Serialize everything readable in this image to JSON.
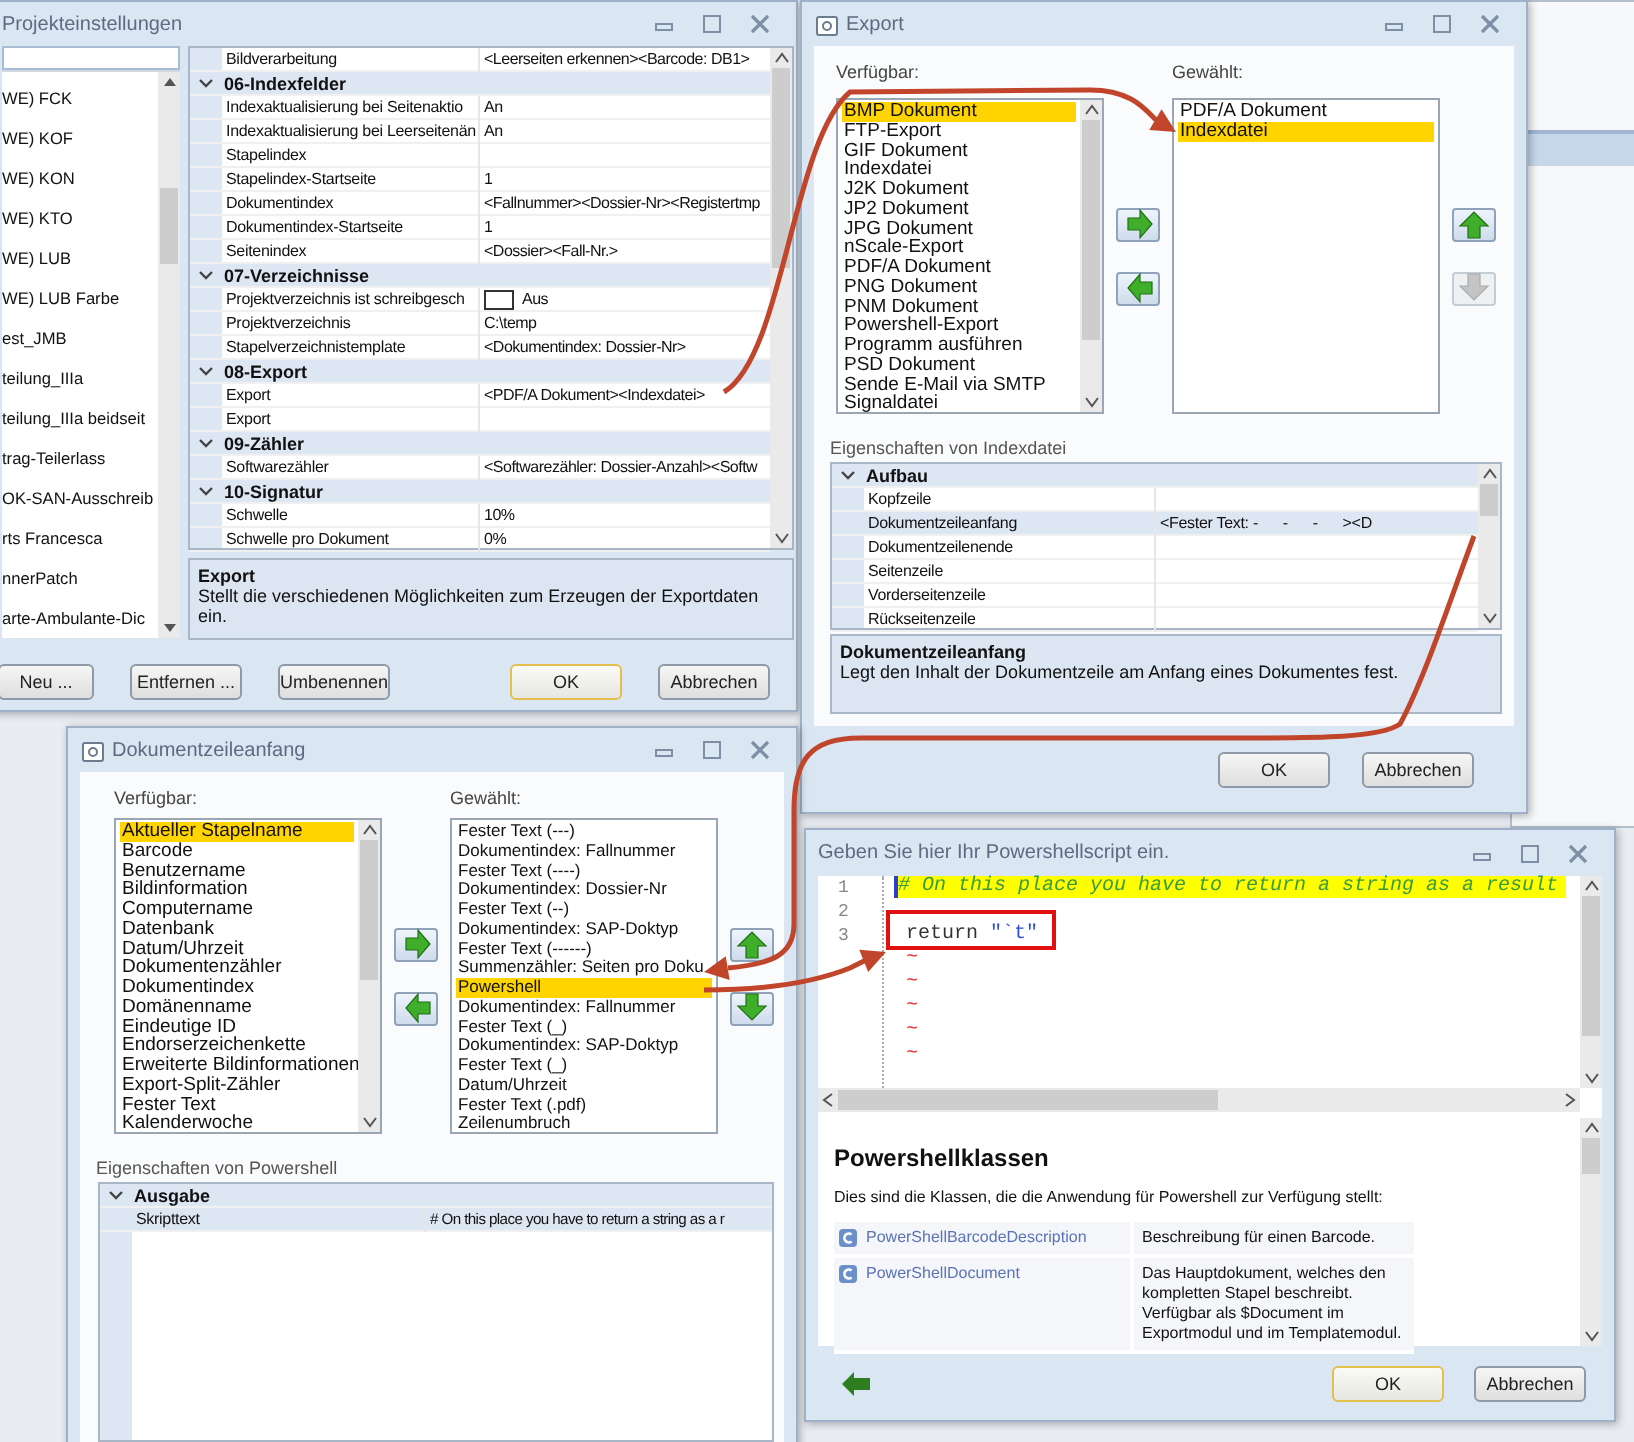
{
  "settings": {
    "title": "Projekteinstellungen",
    "projects": [
      "WE) FCK",
      "WE) KOF",
      "WE) KON",
      "WE) KTO",
      "WE) LUB",
      "WE) LUB Farbe",
      "est_JMB",
      "teilung_IIIa",
      "teilung_IIIa beidseit",
      "trag-Teilerlass",
      "OK-SAN-Ausschreib",
      "rts Francesca",
      "nnerPatch",
      "arte-Ambulante-Dic"
    ],
    "grid": [
      {
        "kind": "property",
        "name": "Bildverarbeitung",
        "value": "<Leerseiten erkennen><Barcode: DB1>"
      },
      {
        "kind": "category",
        "name": "06-Indexfelder"
      },
      {
        "kind": "property",
        "name": "Indexaktualisierung bei Seitenaktio",
        "value": "An"
      },
      {
        "kind": "property",
        "name": "Indexaktualisierung bei Leerseitenän",
        "value": "An"
      },
      {
        "kind": "property",
        "name": "Stapelindex"
      },
      {
        "kind": "property",
        "name": "Stapelindex-Startseite",
        "value": "1"
      },
      {
        "kind": "property",
        "name": "Dokumentindex",
        "value": "<Fallnummer><Dossier-Nr><Registertmp"
      },
      {
        "kind": "property",
        "name": "Dokumentindex-Startseite",
        "value": "1"
      },
      {
        "kind": "property",
        "name": "Seitenindex",
        "value": "<Dossier><Fall-Nr.>"
      },
      {
        "kind": "category",
        "name": "07-Verzeichnisse"
      },
      {
        "kind": "checkbox",
        "name": "Projektverzeichnis ist schreibgesch",
        "value": "Aus",
        "checked": false
      },
      {
        "kind": "property",
        "name": "Projektverzeichnis",
        "value": "C:\\temp"
      },
      {
        "kind": "property",
        "name": "Stapelverzeichnistemplate",
        "value": "<Dokumentindex: Dossier-Nr>"
      },
      {
        "kind": "category",
        "name": "08-Export"
      },
      {
        "kind": "property",
        "name": "Export",
        "value": "<PDF/A Dokument><Indexdatei>"
      },
      {
        "kind": "property",
        "name": "Export"
      },
      {
        "kind": "category",
        "name": "09-Zähler"
      },
      {
        "kind": "property",
        "name": "Softwarezähler",
        "value": "<Softwarezähler: Dossier-Anzahl><Softw"
      },
      {
        "kind": "category",
        "name": "10-Signatur"
      },
      {
        "kind": "property",
        "name": "Schwelle",
        "value": "10%"
      },
      {
        "kind": "property",
        "name": "Schwelle pro Dokument",
        "value": "0%"
      }
    ],
    "description": {
      "title": "Export",
      "text": "Stellt die verschiedenen Möglichkeiten zum Erzeugen der Exportdaten ein."
    },
    "buttons": [
      {
        "label": "Neu ...",
        "default": false
      },
      {
        "label": "Entfernen ...",
        "default": false
      },
      {
        "label": "Umbenennen",
        "default": false
      },
      {
        "label": "OK",
        "default": true
      },
      {
        "label": "Abbrechen",
        "default": false
      }
    ]
  },
  "export": {
    "title": "Export",
    "available_label": "Verfügbar:",
    "chosen_label": "Gewählt:",
    "available": [
      {
        "label": "BMP Dokument",
        "selected": true
      },
      {
        "label": "FTP-Export",
        "selected": false
      },
      {
        "label": "GIF Dokument",
        "selected": false
      },
      {
        "label": "Indexdatei",
        "selected": false
      },
      {
        "label": "J2K Dokument",
        "selected": false
      },
      {
        "label": "JP2 Dokument",
        "selected": false
      },
      {
        "label": "JPG Dokument",
        "selected": false
      },
      {
        "label": "nScale-Export",
        "selected": false
      },
      {
        "label": "PDF/A Dokument",
        "selected": false
      },
      {
        "label": "PNG Dokument",
        "selected": false
      },
      {
        "label": "PNM Dokument",
        "selected": false
      },
      {
        "label": "Powershell-Export",
        "selected": false
      },
      {
        "label": "Programm ausführen",
        "selected": false
      },
      {
        "label": "PSD Dokument",
        "selected": false
      },
      {
        "label": "Sende E-Mail via SMTP",
        "selected": false
      },
      {
        "label": "Signaldatei",
        "selected": false
      }
    ],
    "chosen": [
      {
        "label": "PDF/A Dokument",
        "selected": false
      },
      {
        "label": "Indexdatei",
        "selected": true
      }
    ],
    "move_buttons": [
      {
        "kind": "right",
        "disabled": false
      },
      {
        "kind": "left",
        "disabled": false
      }
    ],
    "order_buttons": [
      {
        "kind": "up",
        "disabled": false
      },
      {
        "kind": "down",
        "disabled": true
      }
    ],
    "properties_label": "Eigenschaften von Indexdatei",
    "grid": [
      {
        "kind": "category",
        "name": "Aufbau",
        "selected": false
      },
      {
        "kind": "property",
        "name": "Kopfzeile",
        "selected": false
      },
      {
        "kind": "property",
        "name": "Dokumentzeileanfang",
        "value": "<Fester Text: -      -      -      ><D",
        "selected": true
      },
      {
        "kind": "property",
        "name": "Dokumentzeilenende",
        "selected": false
      },
      {
        "kind": "property",
        "name": "Seitenzeile",
        "selected": false
      },
      {
        "kind": "property",
        "name": "Vorderseitenzeile",
        "selected": false
      },
      {
        "kind": "property",
        "name": "Rückseitenzeile",
        "selected": false
      }
    ],
    "description": {
      "title": "Dokumentzeileanfang",
      "text": "Legt den Inhalt der Dokumentzeile am Anfang eines Dokumentes fest."
    },
    "buttons": [
      {
        "label": "OK",
        "default": false
      },
      {
        "label": "Abbrechen",
        "default": false
      }
    ]
  },
  "line_window": {
    "title": "Dokumentzeileanfang",
    "available_label": "Verfügbar:",
    "chosen_label": "Gewählt:",
    "available": [
      {
        "label": "Aktueller Stapelname",
        "selected": true
      },
      {
        "label": "Barcode",
        "selected": false
      },
      {
        "label": "Benutzername",
        "selected": false
      },
      {
        "label": "Bildinformation",
        "selected": false
      },
      {
        "label": "Computername",
        "selected": false
      },
      {
        "label": "Datenbank",
        "selected": false
      },
      {
        "label": "Datum/Uhrzeit",
        "selected": false
      },
      {
        "label": "Dokumentenzähler",
        "selected": false
      },
      {
        "label": "Dokumentindex",
        "selected": false
      },
      {
        "label": "Domänenname",
        "selected": false
      },
      {
        "label": "Eindeutige ID",
        "selected": false
      },
      {
        "label": "Endorserzeichenkette",
        "selected": false
      },
      {
        "label": "Erweiterte Bildinformationen",
        "selected": false
      },
      {
        "label": "Export-Split-Zähler",
        "selected": false
      },
      {
        "label": "Fester Text",
        "selected": false
      },
      {
        "label": "Kalenderwoche",
        "selected": false
      }
    ],
    "chosen": [
      {
        "label": "Fester Text (---)",
        "selected": false
      },
      {
        "label": "Dokumentindex: Fallnummer",
        "selected": false
      },
      {
        "label": "Fester Text (----)",
        "selected": false
      },
      {
        "label": "Dokumentindex: Dossier-Nr",
        "selected": false
      },
      {
        "label": "Fester Text (--)",
        "selected": false
      },
      {
        "label": "Dokumentindex: SAP-Doktyp",
        "selected": false
      },
      {
        "label": "Fester Text (------)",
        "selected": false
      },
      {
        "label": "Summenzähler: Seiten pro Doku",
        "selected": false
      },
      {
        "label": "Powershell",
        "selected": true
      },
      {
        "label": "Dokumentindex: Fallnummer",
        "selected": false
      },
      {
        "label": "Fester Text (_)",
        "selected": false
      },
      {
        "label": "Dokumentindex: SAP-Doktyp",
        "selected": false
      },
      {
        "label": "Fester Text (_)",
        "selected": false
      },
      {
        "label": "Datum/Uhrzeit",
        "selected": false
      },
      {
        "label": "Fester Text (.pdf)",
        "selected": false
      },
      {
        "label": "Zeilenumbruch",
        "selected": false
      }
    ],
    "move_buttons": [
      {
        "kind": "right",
        "disabled": false
      },
      {
        "kind": "left",
        "disabled": false
      }
    ],
    "order_buttons": [
      {
        "kind": "up",
        "disabled": false
      },
      {
        "kind": "down",
        "disabled": false
      }
    ],
    "properties_label": "Eigenschaften von Powershell",
    "grid": [
      {
        "kind": "category",
        "name": "Ausgabe",
        "selected": false
      },
      {
        "kind": "property",
        "name": "Skripttext",
        "value": "# On this place you have to return a string as a r",
        "selected": true
      }
    ]
  },
  "script_window": {
    "title": "Geben Sie hier Ihr Powershellscript ein.",
    "lines": [
      {
        "number": "1",
        "kind": "comment",
        "text": "# On this place you have to return a string as a result"
      },
      {
        "number": "2",
        "kind": "blank"
      },
      {
        "number": "3",
        "kind": "code",
        "keyword": "return",
        "string": "\"`t\""
      }
    ],
    "tildes": [
      "~",
      "~",
      "~",
      "~",
      "~"
    ],
    "help": {
      "title": "Powershellklassen",
      "intro": "Dies sind die Klassen, die die Anwendung für Powershell zur Verfügung stellt:",
      "classes": [
        {
          "name": "PowerShellBarcodeDescription",
          "description": "Beschreibung für einen Barcode."
        },
        {
          "name": "PowerShellDocument",
          "description": "Das Hauptdokument, welches den kompletten Stapel beschreibt. Verfügbar als $Document im Exportmodul und im Templatemodul."
        }
      ]
    },
    "buttons": [
      {
        "label": "OK",
        "default": true
      },
      {
        "label": "Abbrechen",
        "default": false
      }
    ]
  }
}
